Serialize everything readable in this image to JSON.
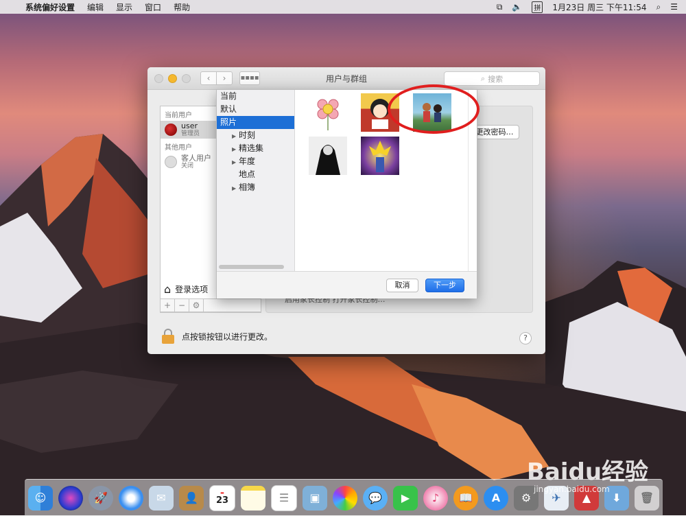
{
  "menubar": {
    "apple": "",
    "app_name": "系统偏好设置",
    "items": [
      "编辑",
      "显示",
      "窗口",
      "帮助"
    ],
    "clock": "1月23日 周三 下午11:54"
  },
  "window": {
    "title": "用户与群组",
    "search_placeholder": "搜索",
    "users": {
      "current_header": "当前用户",
      "current_name": "user",
      "current_role": "管理员",
      "other_header": "其他用户",
      "guest_name": "客人用户",
      "guest_status": "关闭"
    },
    "login_options": "登录选项",
    "change_password": "更改密码…",
    "hidden_row": "启用家长控制    打开家长控制…",
    "lock_text": "点按锁按钮以进行更改。",
    "help": "?"
  },
  "picker": {
    "sidebar": [
      {
        "label": "当前",
        "sel": false,
        "sub": false,
        "tri": false
      },
      {
        "label": "默认",
        "sel": false,
        "sub": false,
        "tri": false
      },
      {
        "label": "照片",
        "sel": true,
        "sub": false,
        "tri": false
      },
      {
        "label": "时刻",
        "sel": false,
        "sub": true,
        "tri": true
      },
      {
        "label": "精选集",
        "sel": false,
        "sub": true,
        "tri": true
      },
      {
        "label": "年度",
        "sel": false,
        "sub": true,
        "tri": true
      },
      {
        "label": "地点",
        "sel": false,
        "sub": true,
        "tri": false
      },
      {
        "label": "相簿",
        "sel": false,
        "sub": true,
        "tri": true
      }
    ],
    "thumbnails": [
      "flower-photo",
      "cartoon-girl-photo",
      "anime-couple-photo",
      "dark-character-photo",
      "anime-warrior-photo"
    ],
    "cancel": "取消",
    "next": "下一步"
  },
  "dock": {
    "icons": [
      "finder-icon",
      "siri-icon",
      "launchpad-icon",
      "safari-icon",
      "mail-icon",
      "contacts-icon",
      "calendar-icon",
      "notes-icon",
      "reminders-icon",
      "preview-icon",
      "photos-icon",
      "messages-icon",
      "facetime-icon",
      "itunes-icon",
      "ibooks-icon",
      "appstore-icon",
      "system-preferences-icon",
      "app-icon",
      "app2-icon",
      "downloads-icon",
      "trash-icon"
    ],
    "calendar_day": "23"
  },
  "watermark": {
    "main": "Baidu经验",
    "sub": "jingyan.baidu.com"
  },
  "colors": {
    "accent": "#1d6fd6",
    "highlight_circle": "#e01e1e"
  }
}
